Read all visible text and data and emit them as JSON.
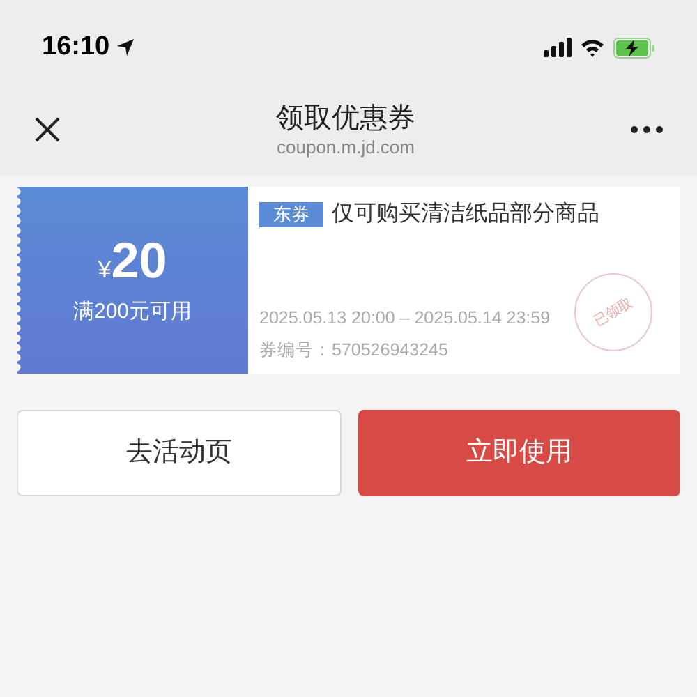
{
  "status_bar": {
    "time": "16:10"
  },
  "nav": {
    "title": "领取优惠券",
    "subtitle": "coupon.m.jd.com"
  },
  "coupon": {
    "currency": "¥",
    "amount": "20",
    "condition": "满200元可用",
    "tag": "东券",
    "description": "仅可购买清洁纸品部分商品",
    "validity": "2025.05.13 20:00 – 2025.05.14 23:59",
    "code": "券编号：570526943245",
    "stamp": "已领取",
    "claimed": true
  },
  "buttons": [
    {
      "label": "去活动页",
      "kind": "secondary"
    },
    {
      "label": "立即使用",
      "kind": "primary"
    }
  ]
}
